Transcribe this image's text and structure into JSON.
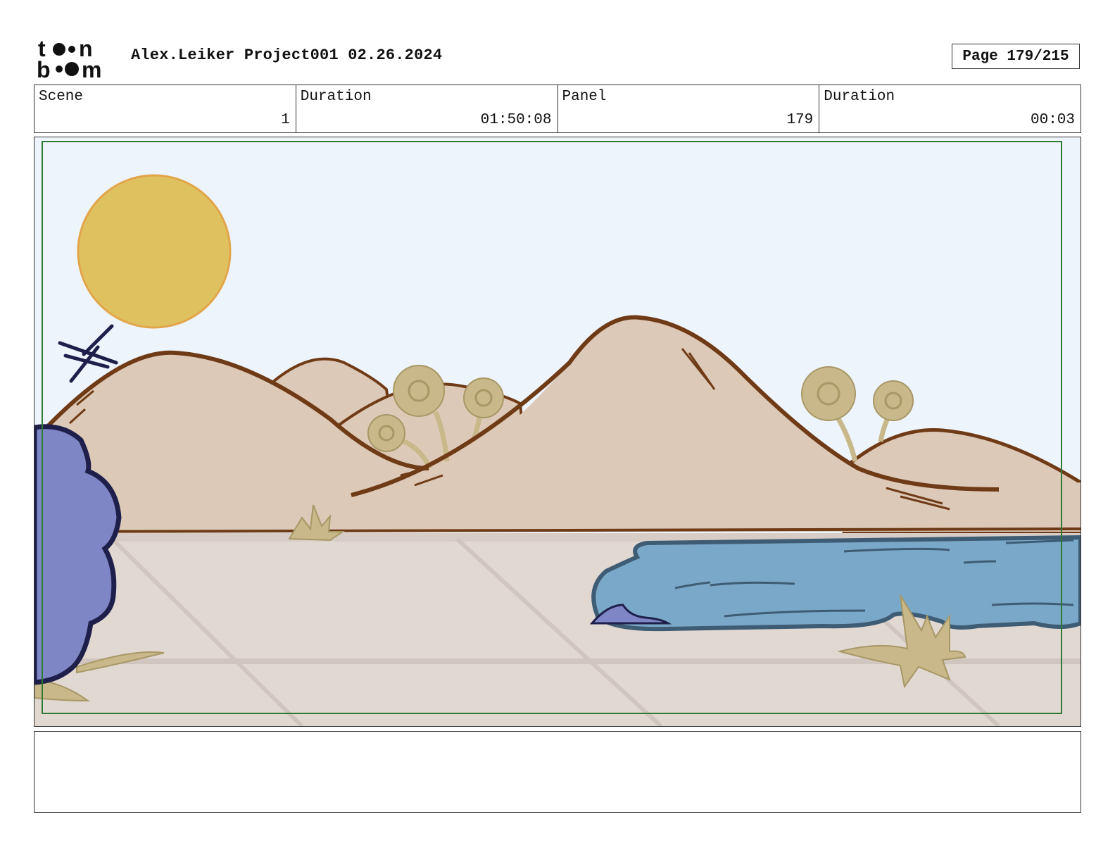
{
  "header": {
    "logo_label": "toon boom",
    "title": "Alex.Leiker Project001 02.26.2024",
    "page_label": "Page 179/215"
  },
  "info": [
    {
      "label": "Scene",
      "value": "1"
    },
    {
      "label": "Duration",
      "value": "01:50:08"
    },
    {
      "label": "Panel",
      "value": "179"
    },
    {
      "label": "Duration",
      "value": "00:03"
    }
  ],
  "panel": {
    "description_icons": [
      "sun",
      "hills",
      "lorax-trees",
      "pond",
      "bush",
      "grass-tufts",
      "hash-marks"
    ],
    "colors": {
      "sky": "#eef4fb",
      "sun": "#dfc25f",
      "hill": "#ddc9b7",
      "hill_outline": "#6f3b16",
      "ground": "#e2d8d2",
      "water": "#7aa8c8",
      "bush": "#7f86c6",
      "grass": "#c8b88a",
      "safe_frame": "#2f7a35"
    }
  },
  "notes": {
    "text": ""
  }
}
